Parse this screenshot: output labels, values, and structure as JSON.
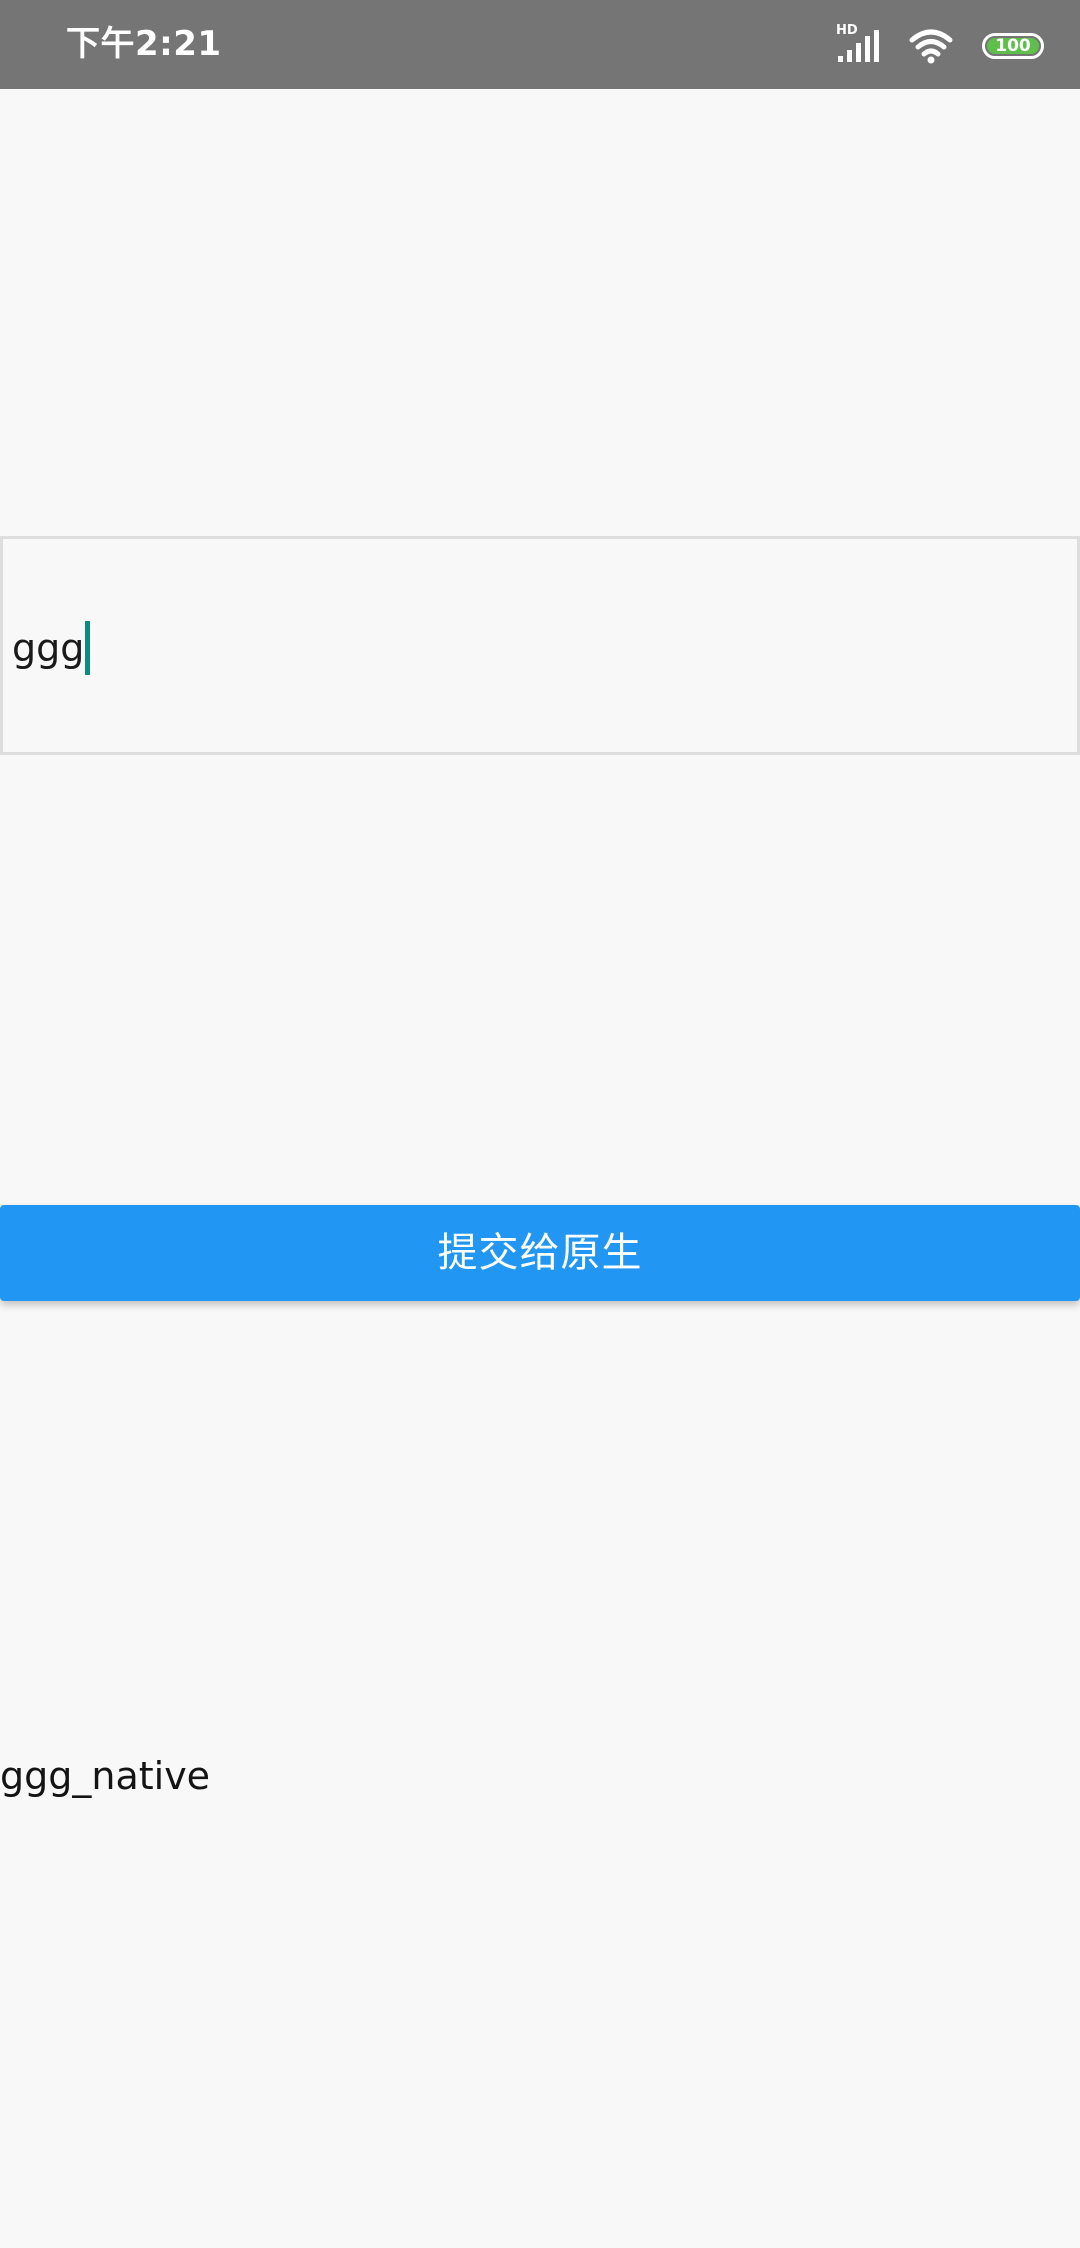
{
  "status_bar": {
    "time": "下午2:21",
    "network_label": "HD",
    "battery_level": "100",
    "icons": [
      "signal-icon",
      "wifi-icon",
      "battery-icon"
    ],
    "battery_color": "#5ec04a"
  },
  "input": {
    "value": "ggg",
    "cursor_color": "#0e8b7d"
  },
  "submit_button": {
    "label": "提交给原生",
    "color": "#2196f3"
  },
  "result": {
    "text": "ggg_native"
  }
}
